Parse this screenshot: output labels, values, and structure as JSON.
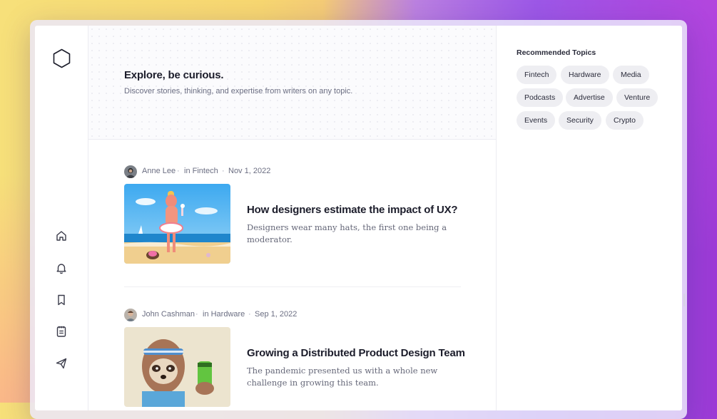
{
  "hero": {
    "title": "Explore, be curious.",
    "subtitle": "Discover stories, thinking, and expertise from writers on any topic."
  },
  "nav": {
    "items": [
      {
        "icon": "home-icon"
      },
      {
        "icon": "bell-icon"
      },
      {
        "icon": "bookmark-icon"
      },
      {
        "icon": "notepad-icon"
      },
      {
        "icon": "send-icon"
      }
    ]
  },
  "articles": [
    {
      "author": "Anne Lee",
      "topic": "in Fintech",
      "date": "Nov 1, 2022",
      "title": "How designers estimate the impact of UX?",
      "description": "Designers wear many hats, the first one being a moderator."
    },
    {
      "author": "John Cashman",
      "topic": "in Hardware",
      "date": "Sep 1, 2022",
      "title": "Growing a Distributed Product Design Team",
      "description": "The pandemic presented us with a whole new challenge in growing this team."
    }
  ],
  "sidebar_right": {
    "title": "Recommended Topics",
    "topics": [
      "Fintech",
      "Hardware",
      "Media",
      "Podcasts",
      "Advertise",
      "Venture",
      "Events",
      "Security",
      "Crypto"
    ]
  },
  "colors": {
    "accent_text": "#1c1d2b",
    "muted_text": "#6b6e82",
    "chip_bg": "#eeeef2"
  }
}
